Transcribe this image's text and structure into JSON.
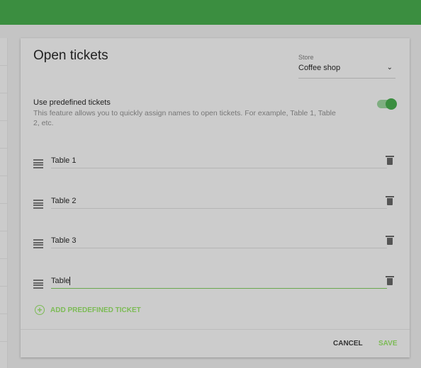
{
  "header": {
    "color": "#3b8e40"
  },
  "dialog": {
    "title": "Open tickets",
    "store": {
      "label": "Store",
      "value": "Coffee shop"
    },
    "option": {
      "title": "Use predefined tickets",
      "description": "This feature allows you to quickly assign names to open tickets. For example, Table 1, Table 2, etc.",
      "enabled": true
    },
    "tickets": [
      {
        "value": "Table 1"
      },
      {
        "value": "Table 2"
      },
      {
        "value": "Table 3"
      },
      {
        "value": "Table"
      }
    ],
    "add_label": "ADD PREDEFINED TICKET",
    "cancel_label": "CANCEL",
    "save_label": "SAVE"
  },
  "colors": {
    "accent": "#7cbb55",
    "highlight": "#f07f2c"
  }
}
